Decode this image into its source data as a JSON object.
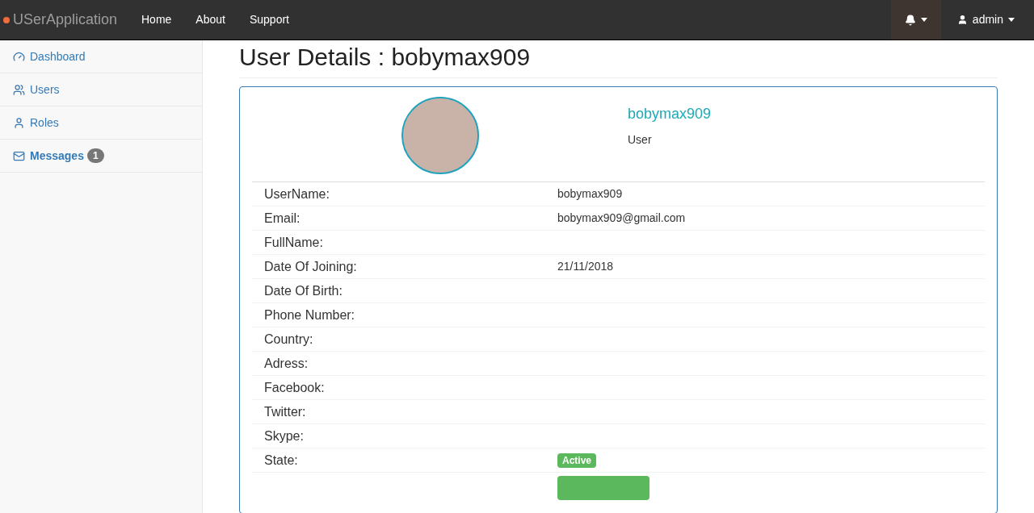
{
  "navbar": {
    "brand": "USerApplication",
    "links": [
      "Home",
      "About",
      "Support"
    ],
    "notifications": {
      "active": true
    },
    "user_menu": {
      "label": "admin"
    }
  },
  "sidebar": {
    "items": [
      {
        "kind": "dashboard",
        "label": "Dashboard",
        "selected": false
      },
      {
        "kind": "users",
        "label": "Users",
        "selected": false
      },
      {
        "kind": "user",
        "label": "Roles",
        "selected": false
      },
      {
        "kind": "mail",
        "label": "Messages",
        "selected": true,
        "badge": "1"
      }
    ]
  },
  "page_title": "User Details : bobymax909",
  "profile": {
    "name": "bobymax909",
    "role": "User"
  },
  "details": [
    {
      "kind": "text",
      "label": "UserName:",
      "value": "bobymax909"
    },
    {
      "kind": "text",
      "label": "Email:",
      "value": "bobymax909@gmail.com"
    },
    {
      "kind": "text",
      "label": "FullName:"
    },
    {
      "kind": "text",
      "label": "Date Of Joining:",
      "value": "21/11/2018"
    },
    {
      "kind": "text",
      "label": "Date Of Birth:"
    },
    {
      "kind": "text",
      "label": "Phone Number:"
    },
    {
      "kind": "text",
      "label": "Country:"
    },
    {
      "kind": "text",
      "label": "Adress:"
    },
    {
      "kind": "text",
      "label": "Facebook:"
    },
    {
      "kind": "text",
      "label": "Twitter:"
    },
    {
      "kind": "text",
      "label": "Skype:"
    },
    {
      "kind": "badge",
      "label": "State:",
      "value": "Active"
    }
  ]
}
